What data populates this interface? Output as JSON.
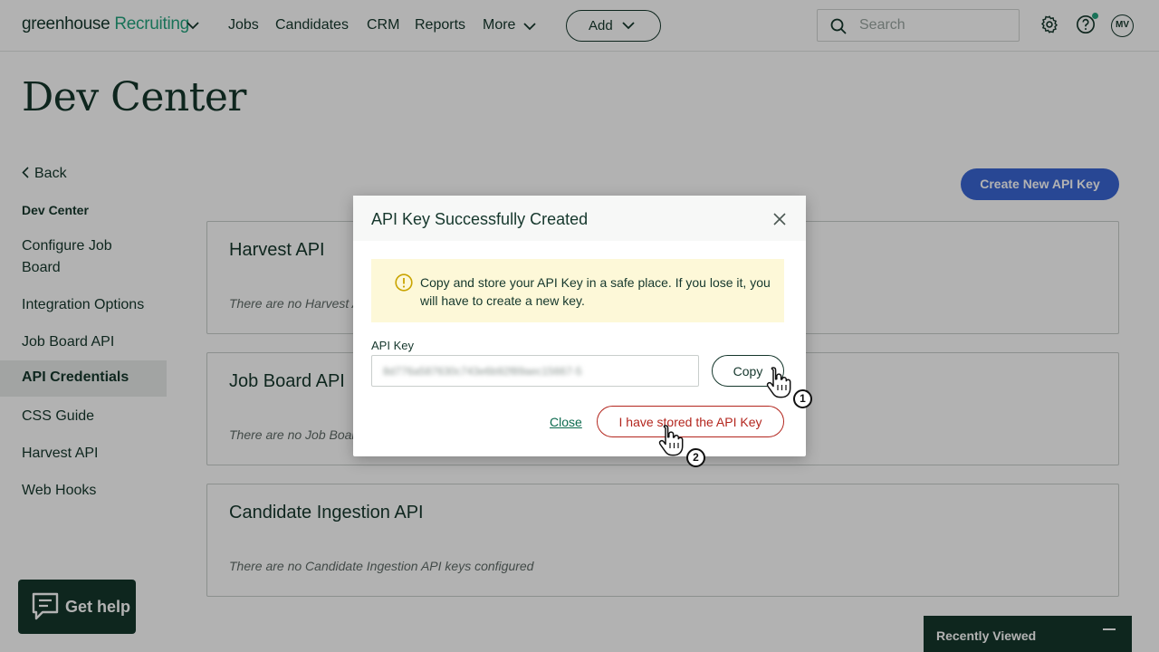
{
  "app": {
    "logo_part1": "greenhouse",
    "logo_part2": "Recruiting"
  },
  "nav": {
    "items": [
      "Jobs",
      "Candidates",
      "CRM",
      "Reports",
      "More"
    ],
    "add_label": "Add",
    "search_placeholder": "Search",
    "avatar_initials": "MV"
  },
  "page": {
    "title": "Dev Center"
  },
  "sidebar": {
    "back_label": "Back",
    "heading": "Dev Center",
    "items": [
      {
        "label": "Configure Job Board"
      },
      {
        "label": "Integration Options"
      },
      {
        "label": "Job Board API"
      },
      {
        "label": "API Credentials",
        "active": true
      },
      {
        "label": "CSS Guide"
      },
      {
        "label": "Harvest API"
      },
      {
        "label": "Web Hooks"
      }
    ]
  },
  "main": {
    "create_button": "Create New API Key",
    "cards": [
      {
        "title": "Harvest API",
        "empty_text": "There are no Harvest API keys configured"
      },
      {
        "title": "Job Board API",
        "empty_text": "There are no Job Board API keys configured"
      },
      {
        "title": "Candidate Ingestion API",
        "empty_text": "There are no Candidate Ingestion API keys configured"
      }
    ]
  },
  "modal": {
    "title": "API Key Successfully Created",
    "warning": "Copy and store your API Key in a safe place. If you lose it, you will have to create a new key.",
    "key_label": "API Key",
    "key_value": "8d776a587630c743e6b92f89aec15667-5",
    "copy_label": "Copy",
    "close_label": "Close",
    "stored_label": "I have stored the API Key"
  },
  "annotations": {
    "step1": "1",
    "step2": "2"
  },
  "footer": {
    "get_help": "Get help",
    "recently_viewed": "Recently Viewed"
  },
  "colors": {
    "brand_green": "#24a47f",
    "dark_green": "#15372c",
    "primary_blue": "#3a66d5",
    "danger_red": "#b3261e",
    "warning_bg": "#fdf8d8"
  }
}
